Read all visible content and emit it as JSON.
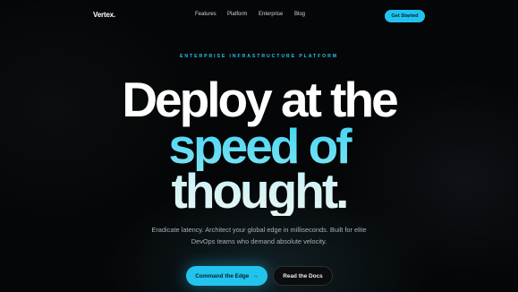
{
  "nav": {
    "logo": "Vertex.",
    "links": [
      "Features",
      "Platform",
      "Enterprise",
      "Blog"
    ],
    "cta_label": "Get Started"
  },
  "hero": {
    "eyebrow": "ENTERPRISE INFRASTRUCTURE PLATFORM",
    "headline_line1": "Deploy at the",
    "headline_line2": "speed of",
    "headline_line3": "thought.",
    "subtitle_line1": "Eradicate latency. Architect your global edge in milliseconds. Built for elite",
    "subtitle_line2": "DevOps teams who demand absolute velocity.",
    "primary_cta": "Command the Edge",
    "primary_cta_arrow": "→",
    "secondary_cta": "Read the Docs"
  },
  "colors": {
    "accent": "#22c4ee",
    "background": "#050607"
  }
}
